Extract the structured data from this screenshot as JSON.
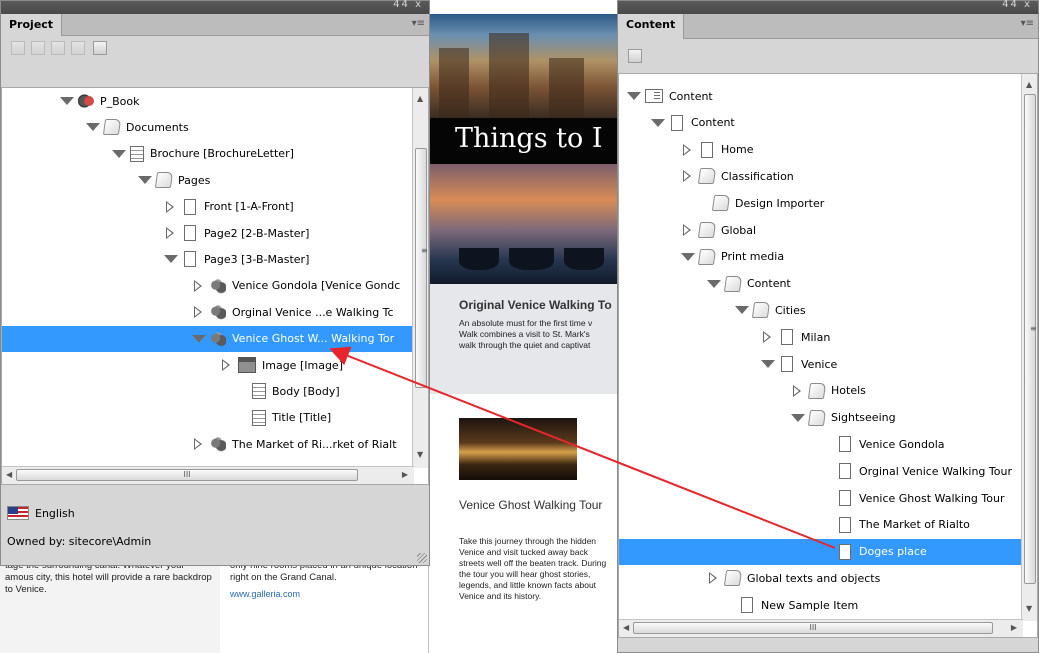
{
  "document": {
    "left_text": "tage the surrounding canal. Whatever your amous city, this hotel will provide a rare backdrop to Venice.",
    "mid_text": "only nine rooms placed in an unique location right on the Grand Canal.",
    "mid_link": "www.galleria.com",
    "headline": "Things to I",
    "article1_title": "Original Venice Walking To",
    "article1_lines": [
      "An absolute must for the first time v",
      "Walk combines a visit to St. Mark's",
      "walk through the quiet and captivat"
    ],
    "article2_title": "Venice Ghost Walking Tour",
    "article2_text": "Take this journey through the hidden Venice and visit tucked away back streets well off the beaten track. During the tour you will hear ghost stories, legends, and little known facts about Venice and its history."
  },
  "project_panel": {
    "panel_controls": "44 x",
    "tab_label": "Project",
    "menu_icon": "panel-menu-icon",
    "toolbar_icons": [
      "layout-icon",
      "save-icon",
      "export-icon",
      "import-icon",
      "sitecore-icon"
    ],
    "tree": [
      {
        "label": "P_Book",
        "icon": "book-icon",
        "expander": "open"
      },
      {
        "label": "Documents",
        "icon": "folder-icon",
        "expander": "open"
      },
      {
        "label": "Brochure [BrochureLetter]",
        "icon": "document-icon",
        "expander": "open"
      },
      {
        "label": "Pages",
        "icon": "folder-icon",
        "expander": "open"
      },
      {
        "label": "Front [1-A-Front]",
        "icon": "page-icon",
        "expander": "closed"
      },
      {
        "label": "Page2 [2-B-Master]",
        "icon": "page-icon",
        "expander": "closed"
      },
      {
        "label": "Page3 [3-B-Master]",
        "icon": "page-icon",
        "expander": "open"
      },
      {
        "label": "Venice Gondola [Venice Gondc",
        "icon": "snippet-group-icon",
        "expander": "closed"
      },
      {
        "label": "Orginal Venice ...e Walking Tc",
        "icon": "snippet-group-icon",
        "expander": "closed"
      },
      {
        "label": "Venice Ghost W... Walking Tor",
        "icon": "snippet-group-icon",
        "expander": "open",
        "selected": true
      },
      {
        "label": "Image [Image]",
        "icon": "image-icon",
        "expander": "closed"
      },
      {
        "label": "Body [Body]",
        "icon": "text-frame-icon",
        "expander": "none"
      },
      {
        "label": "Title [Title]",
        "icon": "text-frame-icon",
        "expander": "none"
      },
      {
        "label": "The Market of Ri...rket of Rialt",
        "icon": "snippet-group-icon",
        "expander": "closed"
      }
    ],
    "hscroll_thumb": "III",
    "language": "English",
    "owner": "Owned by: sitecore\\Admin"
  },
  "content_panel": {
    "panel_controls": "44 x",
    "tab_label": "Content",
    "menu_icon": "panel-menu-icon",
    "toolbar_icons": [
      "sitecore-icon"
    ],
    "tree": [
      {
        "label": "Content",
        "icon": "content-root-icon",
        "expander": "open"
      },
      {
        "label": "Content",
        "icon": "page-icon",
        "expander": "open"
      },
      {
        "label": "Home",
        "icon": "page-icon",
        "expander": "closed"
      },
      {
        "label": "Classification",
        "icon": "folder-icon",
        "expander": "closed"
      },
      {
        "label": "Design Importer",
        "icon": "folder-icon",
        "expander": "none"
      },
      {
        "label": "Global",
        "icon": "folder-icon",
        "expander": "closed"
      },
      {
        "label": "Print media",
        "icon": "folder-icon",
        "expander": "open"
      },
      {
        "label": "Content",
        "icon": "folder-icon",
        "expander": "open"
      },
      {
        "label": "Cities",
        "icon": "folder-icon",
        "expander": "open"
      },
      {
        "label": "Milan",
        "icon": "page-icon",
        "expander": "closed"
      },
      {
        "label": "Venice",
        "icon": "page-icon",
        "expander": "open"
      },
      {
        "label": "Hotels",
        "icon": "folder-icon",
        "expander": "closed"
      },
      {
        "label": "Sightseeing",
        "icon": "folder-icon",
        "expander": "open"
      },
      {
        "label": "Venice Gondola",
        "icon": "page-icon",
        "expander": "none"
      },
      {
        "label": "Orginal Venice Walking Tour",
        "icon": "page-icon",
        "expander": "none"
      },
      {
        "label": "Venice Ghost Walking Tour",
        "icon": "page-icon",
        "expander": "none"
      },
      {
        "label": "The Market of Rialto",
        "icon": "page-icon",
        "expander": "none"
      },
      {
        "label": "Doges place",
        "icon": "page-icon",
        "expander": "none",
        "selected": true
      },
      {
        "label": "Global texts and objects",
        "icon": "folder-icon",
        "expander": "closed"
      },
      {
        "label": "New Sample Item",
        "icon": "page-icon",
        "expander": "none"
      }
    ],
    "hscroll_thumb": "III"
  },
  "colors": {
    "selection": "#3399ff",
    "arrow": "#e8252a"
  }
}
